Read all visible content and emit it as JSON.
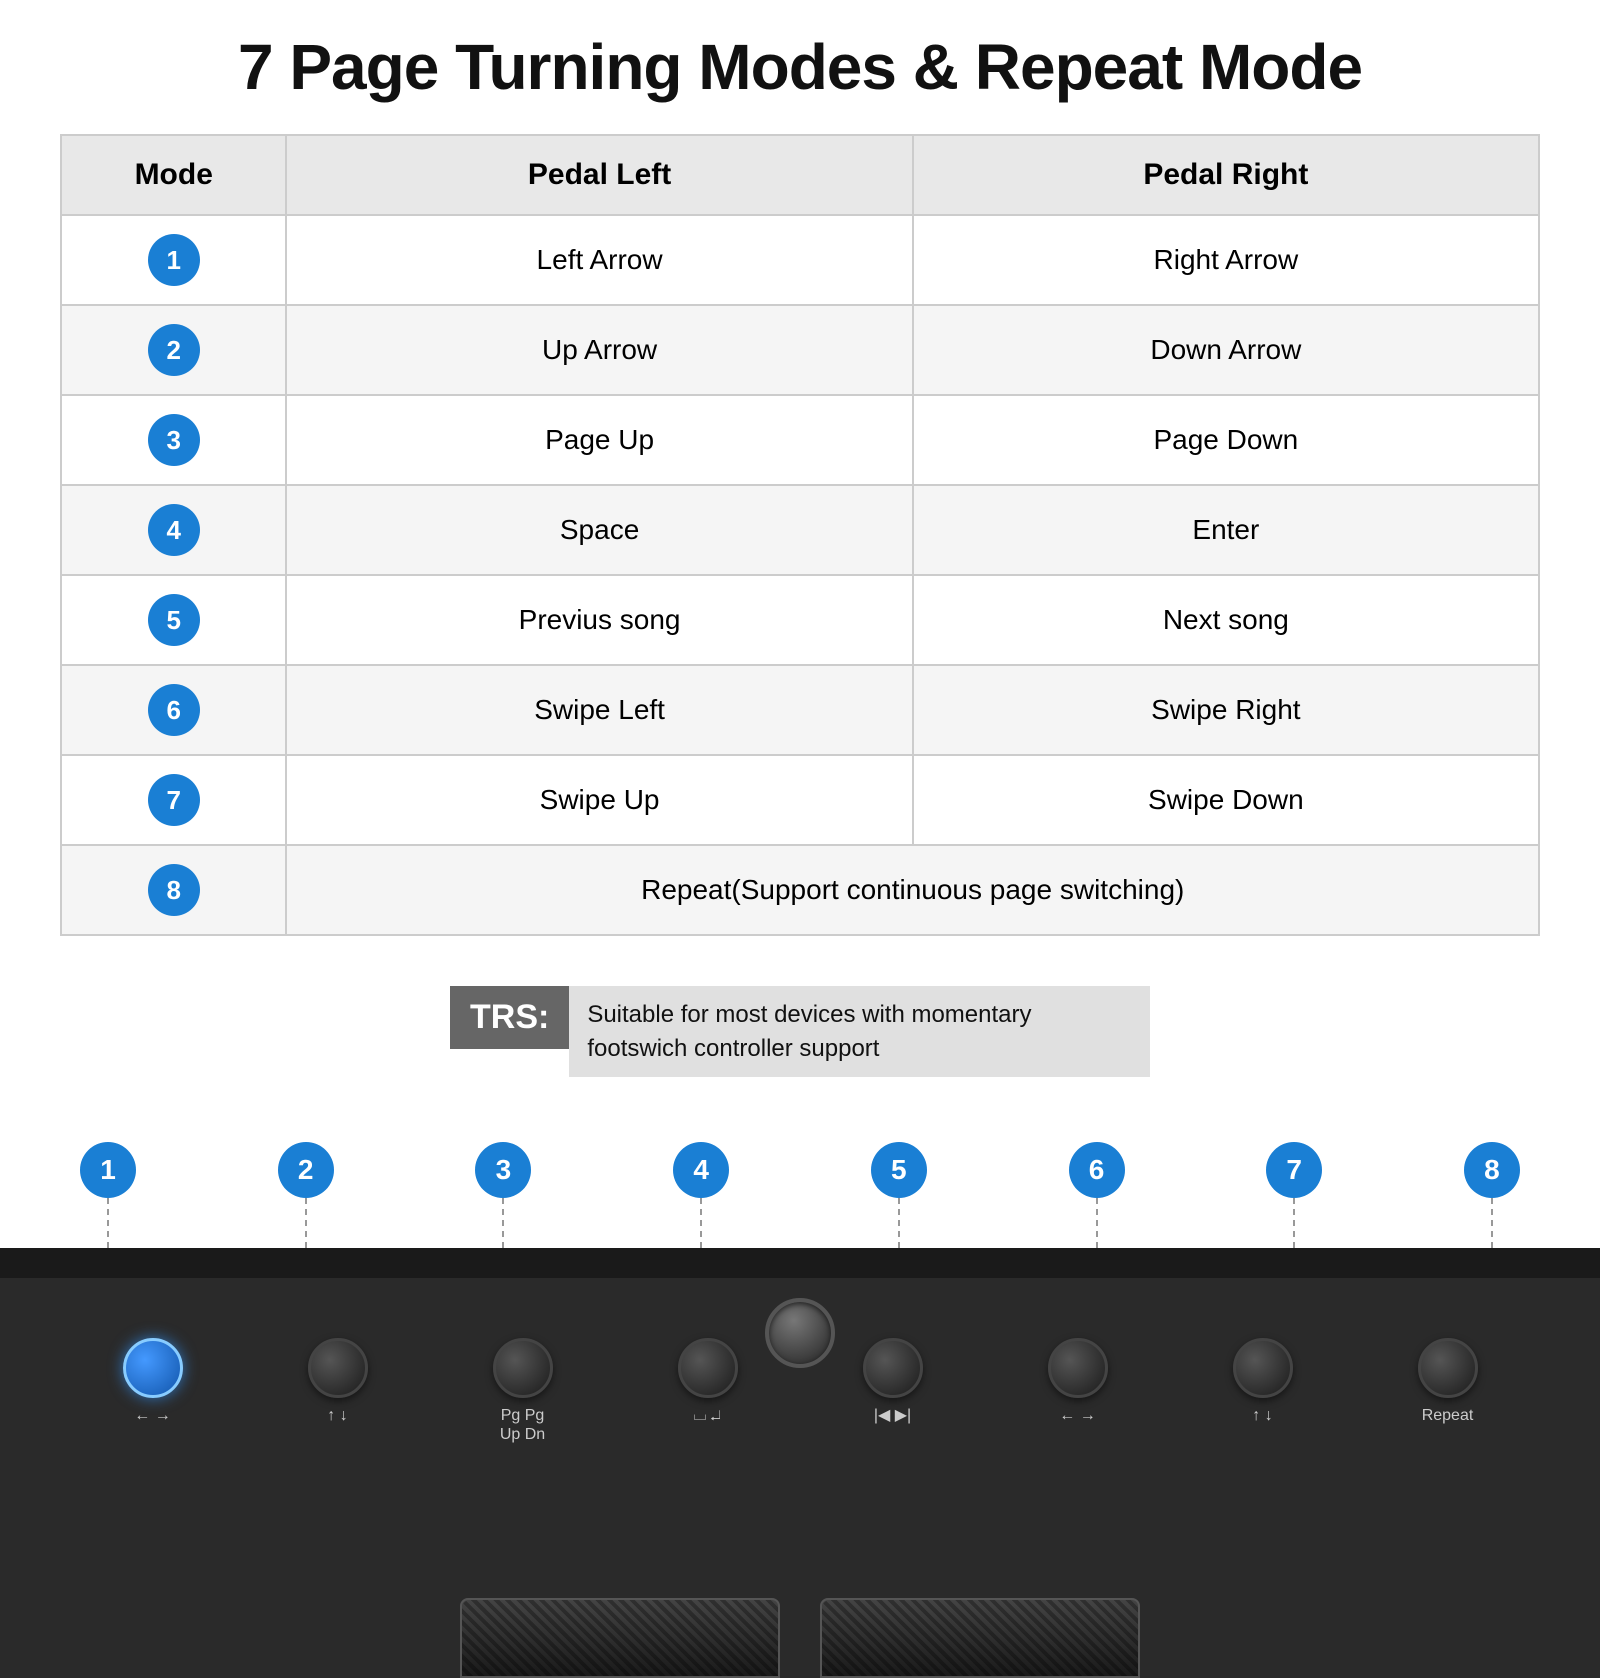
{
  "title": "7 Page Turning Modes & Repeat Mode",
  "table": {
    "headers": {
      "mode": "Mode",
      "pedal_left": "Pedal Left",
      "pedal_right": "Pedal Right"
    },
    "rows": [
      {
        "num": "1",
        "left": "Left Arrow",
        "right": "Right Arrow",
        "span": false
      },
      {
        "num": "2",
        "left": "Up Arrow",
        "right": "Down Arrow",
        "span": false
      },
      {
        "num": "3",
        "left": "Page Up",
        "right": "Page Down",
        "span": false
      },
      {
        "num": "4",
        "left": "Space",
        "right": "Enter",
        "span": false
      },
      {
        "num": "5",
        "left": "Previus song",
        "right": "Next song",
        "span": false
      },
      {
        "num": "6",
        "left": "Swipe Left",
        "right": "Swipe Right",
        "span": false
      },
      {
        "num": "7",
        "left": "Swipe Up",
        "right": "Swipe Down",
        "span": false
      },
      {
        "num": "8",
        "left": "Repeat(Support continuous page switching)",
        "right": "",
        "span": true
      }
    ]
  },
  "trs": {
    "label": "TRS:",
    "description": "Suitable for most devices with momentary\nfootswich controller support"
  },
  "mode_buttons": [
    {
      "num": "1"
    },
    {
      "num": "2"
    },
    {
      "num": "3"
    },
    {
      "num": "4"
    },
    {
      "num": "5"
    },
    {
      "num": "6"
    },
    {
      "num": "7"
    },
    {
      "num": "8"
    }
  ],
  "device": {
    "buttons": [
      {
        "label": "← →",
        "active": true
      },
      {
        "label": "↑ ↓",
        "active": false
      },
      {
        "label": "Pg Pg\nUp Dn",
        "active": false
      },
      {
        "label": "⌴ ↵",
        "active": false
      },
      {
        "label": "|◀ ▶|",
        "active": false
      },
      {
        "label": "← →",
        "active": false
      },
      {
        "label": "↑ ↓",
        "active": false
      },
      {
        "label": "Repeat",
        "active": false
      }
    ]
  }
}
